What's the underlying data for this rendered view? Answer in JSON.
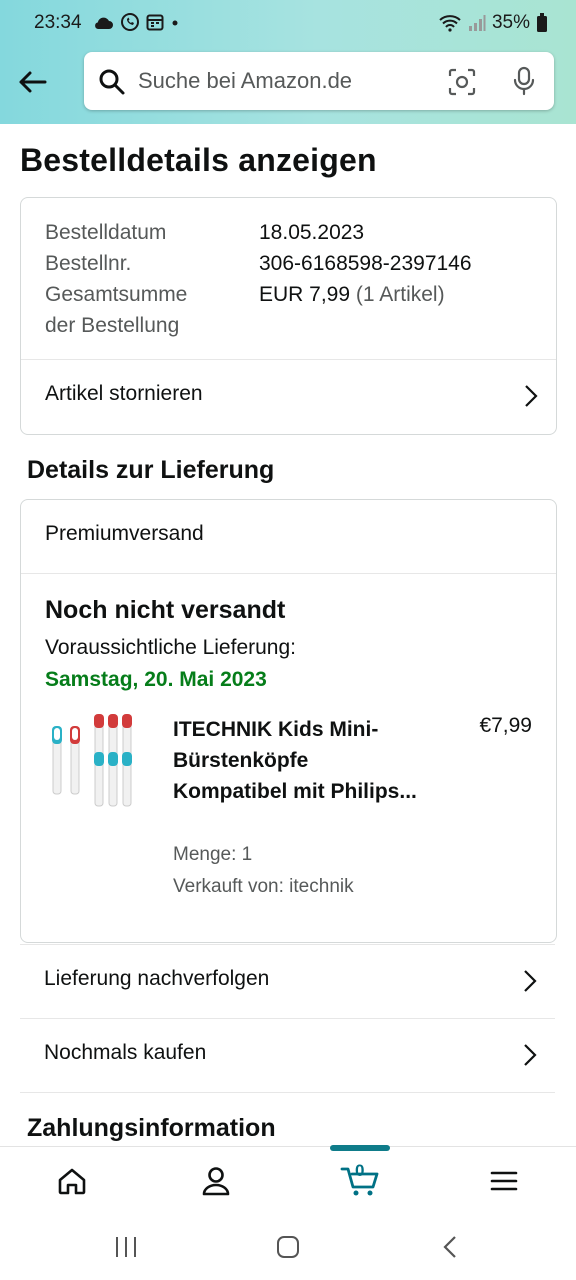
{
  "status_bar": {
    "time": "23:34",
    "battery": "35%"
  },
  "search": {
    "placeholder": "Suche bei Amazon.de"
  },
  "page": {
    "title": "Bestelldetails anzeigen"
  },
  "order": {
    "date_label": "Bestelldatum",
    "date_value": "18.05.2023",
    "number_label": "Bestellnr.",
    "number_value": "306-6168598-2397146",
    "total_label_1": "Gesamtsumme",
    "total_label_2": "der Bestellung",
    "total_value": "EUR 7,99",
    "total_items": "(1 Artikel)",
    "cancel_label": "Artikel stornieren"
  },
  "delivery": {
    "heading": "Details zur Lieferung",
    "shipping_method": "Premiumversand",
    "status": "Noch nicht versandt",
    "eta_label": "Voraussichtliche Lieferung:",
    "eta_date": "Samstag, 20. Mai 2023",
    "product": {
      "name": "ITECHNIK Kids Mini-Bürstenköpfe Kompatibel mit Philips...",
      "price": "€7,99",
      "quantity": "Menge: 1",
      "seller": "Verkauft von: itechnik"
    },
    "track_label": "Lieferung nachverfolgen",
    "buy_again_label": "Nochmals kaufen"
  },
  "payment": {
    "heading": "Zahlungsinformation"
  },
  "bottom_nav": {
    "cart_count": "0"
  },
  "colors": {
    "accent_teal": "#0f7c8a",
    "eta_green": "#067d1a",
    "header_gradient_start": "#84d8dd"
  }
}
